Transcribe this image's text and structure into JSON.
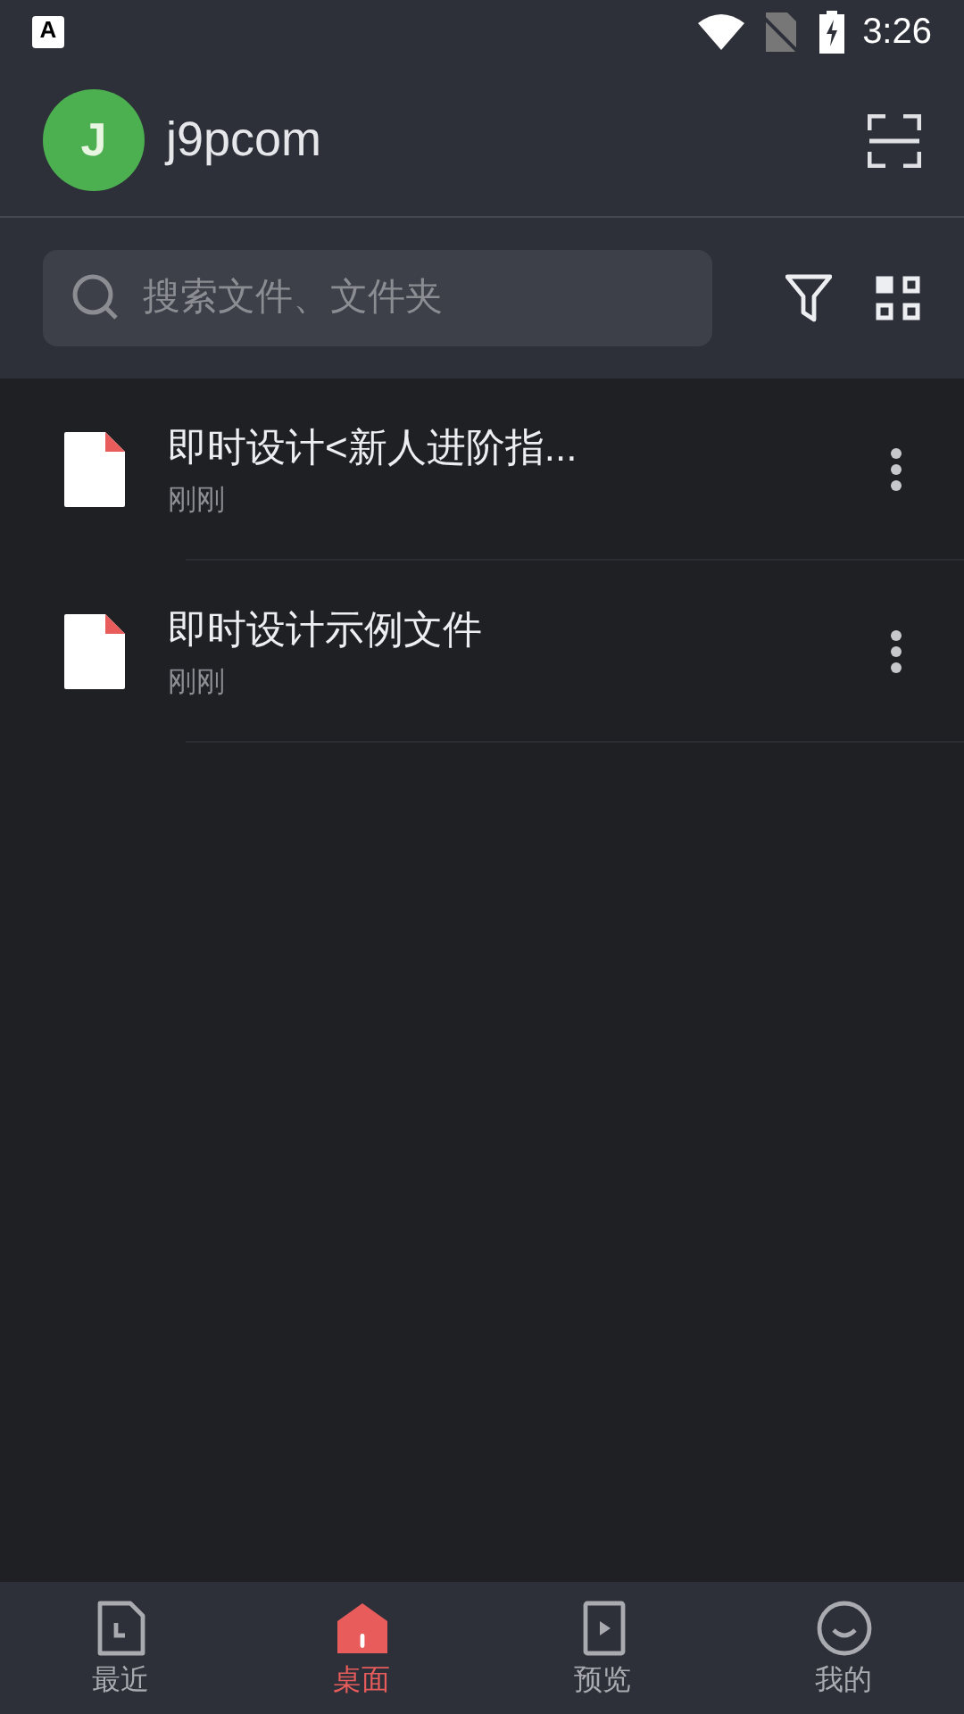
{
  "status_bar": {
    "time": "3:26",
    "notice_glyph": "A"
  },
  "header": {
    "avatar_letter": "J",
    "username": "j9pcom"
  },
  "search": {
    "placeholder": "搜索文件、文件夹"
  },
  "files": [
    {
      "name": "即时设计<新人进阶指...",
      "time": "刚刚"
    },
    {
      "name": "即时设计示例文件",
      "time": "刚刚"
    }
  ],
  "tabs": [
    {
      "kind": "recent",
      "label": "最近",
      "selected": false
    },
    {
      "kind": "desktop",
      "label": "桌面",
      "selected": true
    },
    {
      "kind": "preview",
      "label": "预览",
      "selected": false
    },
    {
      "kind": "me",
      "label": "我的",
      "selected": false
    }
  ]
}
